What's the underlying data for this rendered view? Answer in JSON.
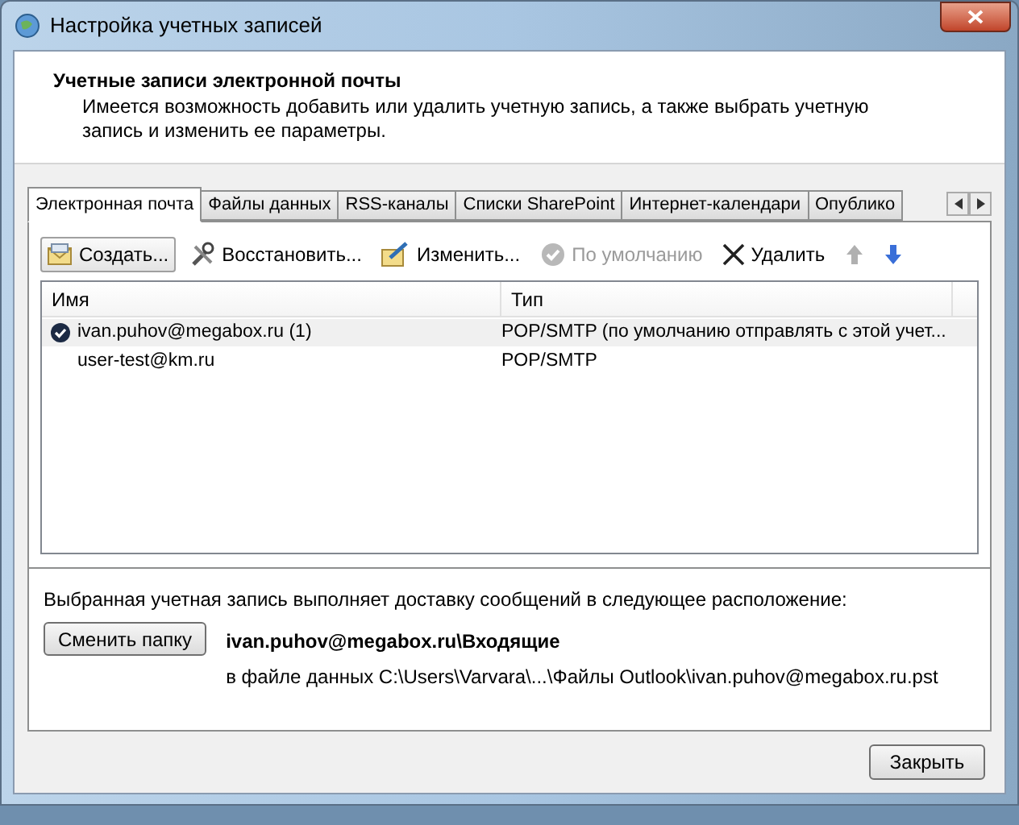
{
  "window": {
    "title": "Настройка учетных записей"
  },
  "header": {
    "title": "Учетные записи электронной почты",
    "description": "Имеется возможность добавить или удалить учетную запись, а также выбрать учетную запись и изменить ее параметры."
  },
  "tabs": [
    {
      "label": "Электронная почта",
      "selected": true
    },
    {
      "label": "Файлы данных",
      "selected": false
    },
    {
      "label": "RSS-каналы",
      "selected": false
    },
    {
      "label": "Списки SharePoint",
      "selected": false
    },
    {
      "label": "Интернет-календари",
      "selected": false
    },
    {
      "label": "Опублико",
      "selected": false
    }
  ],
  "toolbar": [
    {
      "kind": "new",
      "label": "Создать...",
      "disabled": false
    },
    {
      "kind": "repair",
      "label": "Восстановить...",
      "disabled": false
    },
    {
      "kind": "change",
      "label": "Изменить...",
      "disabled": false
    },
    {
      "kind": "default",
      "label": "По умолчанию",
      "disabled": true
    },
    {
      "kind": "delete",
      "label": "Удалить",
      "disabled": false
    },
    {
      "kind": "up",
      "disabled": true
    },
    {
      "kind": "down",
      "disabled": false
    }
  ],
  "table": {
    "columns": [
      "Имя",
      "Тип"
    ],
    "rows": [
      {
        "name": "ivan.puhov@megabox.ru (1)",
        "type": "POP/SMTP (по умолчанию отправлять с этой учет...",
        "default": true,
        "selected": true
      },
      {
        "name": "user-test@km.ru",
        "type": "POP/SMTP",
        "default": false,
        "selected": false
      }
    ]
  },
  "delivery": {
    "caption": "Выбранная учетная запись выполняет доставку сообщений в следующее расположение:",
    "button": "Сменить папку",
    "folder": "ivan.puhov@megabox.ru\\Входящие",
    "file": "в файле данных C:\\Users\\Varvara\\...\\Файлы Outlook\\ivan.puhov@megabox.ru.pst"
  },
  "buttons": [
    "Закрыть"
  ]
}
